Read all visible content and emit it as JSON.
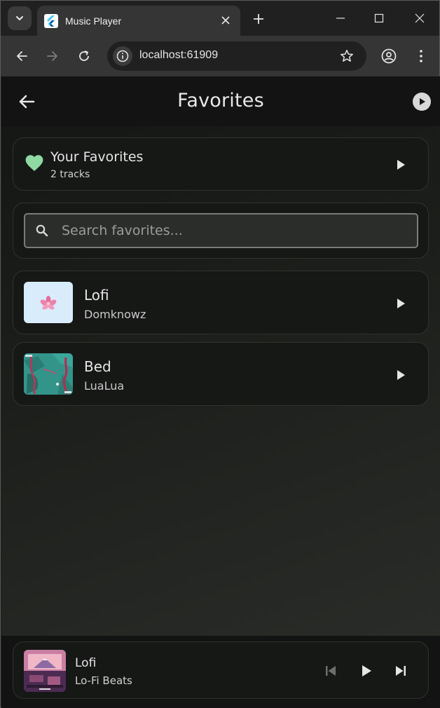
{
  "browser": {
    "tab_title": "Music Player",
    "url": "localhost:61909"
  },
  "app": {
    "page_title": "Favorites",
    "favorites_card": {
      "title": "Your Favorites",
      "count": "2 tracks"
    },
    "search": {
      "placeholder": "Search favorites..."
    },
    "tracks": [
      {
        "title": "Lofi",
        "artist": "Domknowz",
        "art_icon": "flower-icon"
      },
      {
        "title": "Bed",
        "artist": "LuaLua",
        "art_icon": "abstract-art"
      }
    ],
    "now_playing": {
      "title": "Lofi",
      "subtitle": "Lo-Fi Beats"
    }
  },
  "colors": {
    "accent_heart": "#8fd9a2",
    "background": "#1c1e1b",
    "card": "#161816"
  }
}
